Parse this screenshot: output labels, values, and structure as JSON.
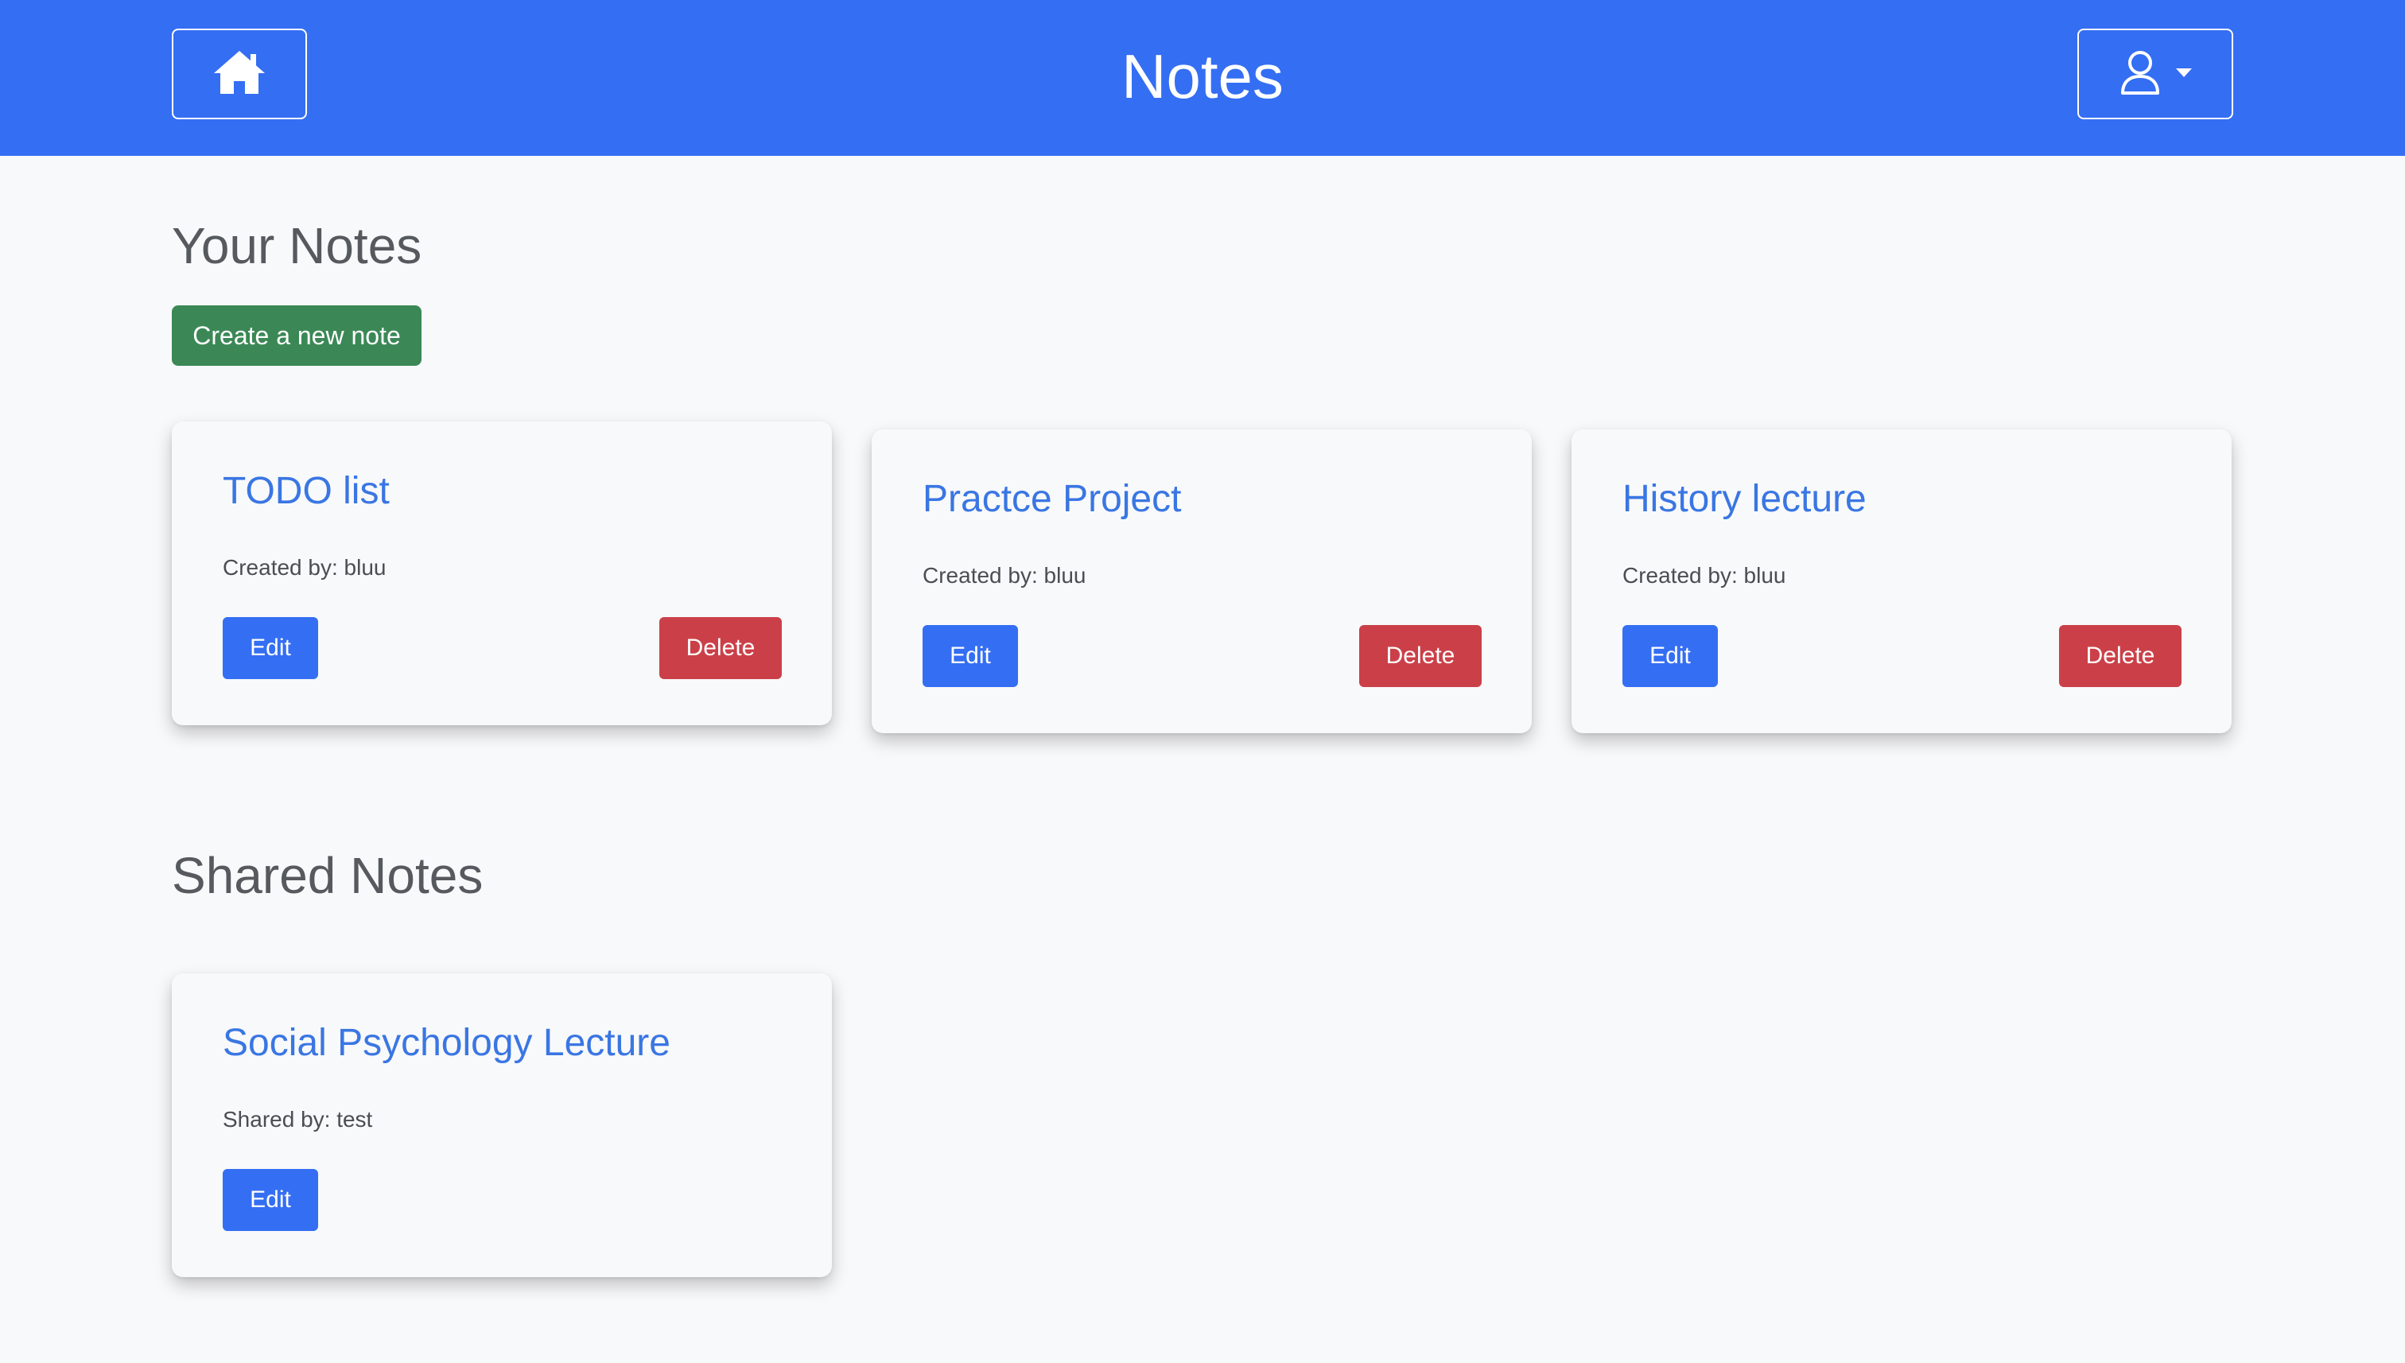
{
  "navbar": {
    "title": "Notes",
    "home_icon": "home-icon",
    "user_icon": "user-icon",
    "background_color": "#346ef3"
  },
  "your_notes": {
    "heading": "Your Notes",
    "create_label": "Create a new note",
    "notes": [
      {
        "title": "TODO list",
        "meta": "Created by: bluu",
        "edit_label": "Edit",
        "delete_label": "Delete"
      },
      {
        "title": "Practce Project",
        "meta": "Created by: bluu",
        "edit_label": "Edit",
        "delete_label": "Delete"
      },
      {
        "title": "History lecture",
        "meta": "Created by: bluu",
        "edit_label": "Edit",
        "delete_label": "Delete"
      }
    ]
  },
  "shared_notes": {
    "heading": "Shared Notes",
    "notes": [
      {
        "title": "Social Psychology Lecture",
        "meta": "Shared by: test",
        "edit_label": "Edit"
      }
    ]
  },
  "colors": {
    "primary": "#346ef3",
    "success": "#3b8856",
    "danger": "#cb4048",
    "link": "#3a76e3"
  }
}
